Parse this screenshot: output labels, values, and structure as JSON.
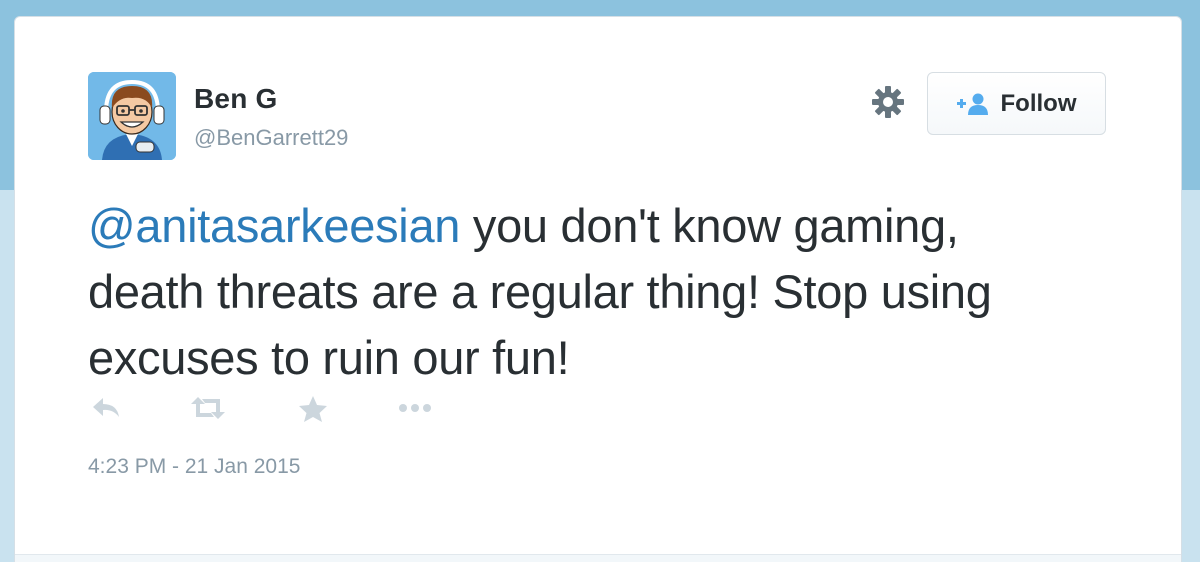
{
  "user": {
    "display_name": "Ben G",
    "handle": "@BenGarrett29",
    "avatar_icon": "cartoon-gamer-avatar"
  },
  "follow_button": {
    "label": "Follow",
    "icon": "add-user-icon"
  },
  "tweet": {
    "mention": "@anitasarkeesian",
    "text_line1": " you don't know gaming,",
    "text_line2": "death threats are a regular thing! Stop using",
    "text_line3": "excuses to ruin our fun!"
  },
  "actions": {
    "reply_icon": "reply-icon",
    "retweet_icon": "retweet-icon",
    "favorite_icon": "star-icon",
    "more_icon": "more-icon"
  },
  "timestamp": "4:23 PM - 21 Jan 2015",
  "colors": {
    "background": "#8cc2de",
    "text": "#292f33",
    "muted": "#8899a6",
    "link": "#2b7bb9",
    "icon": "#ccd6dd"
  }
}
